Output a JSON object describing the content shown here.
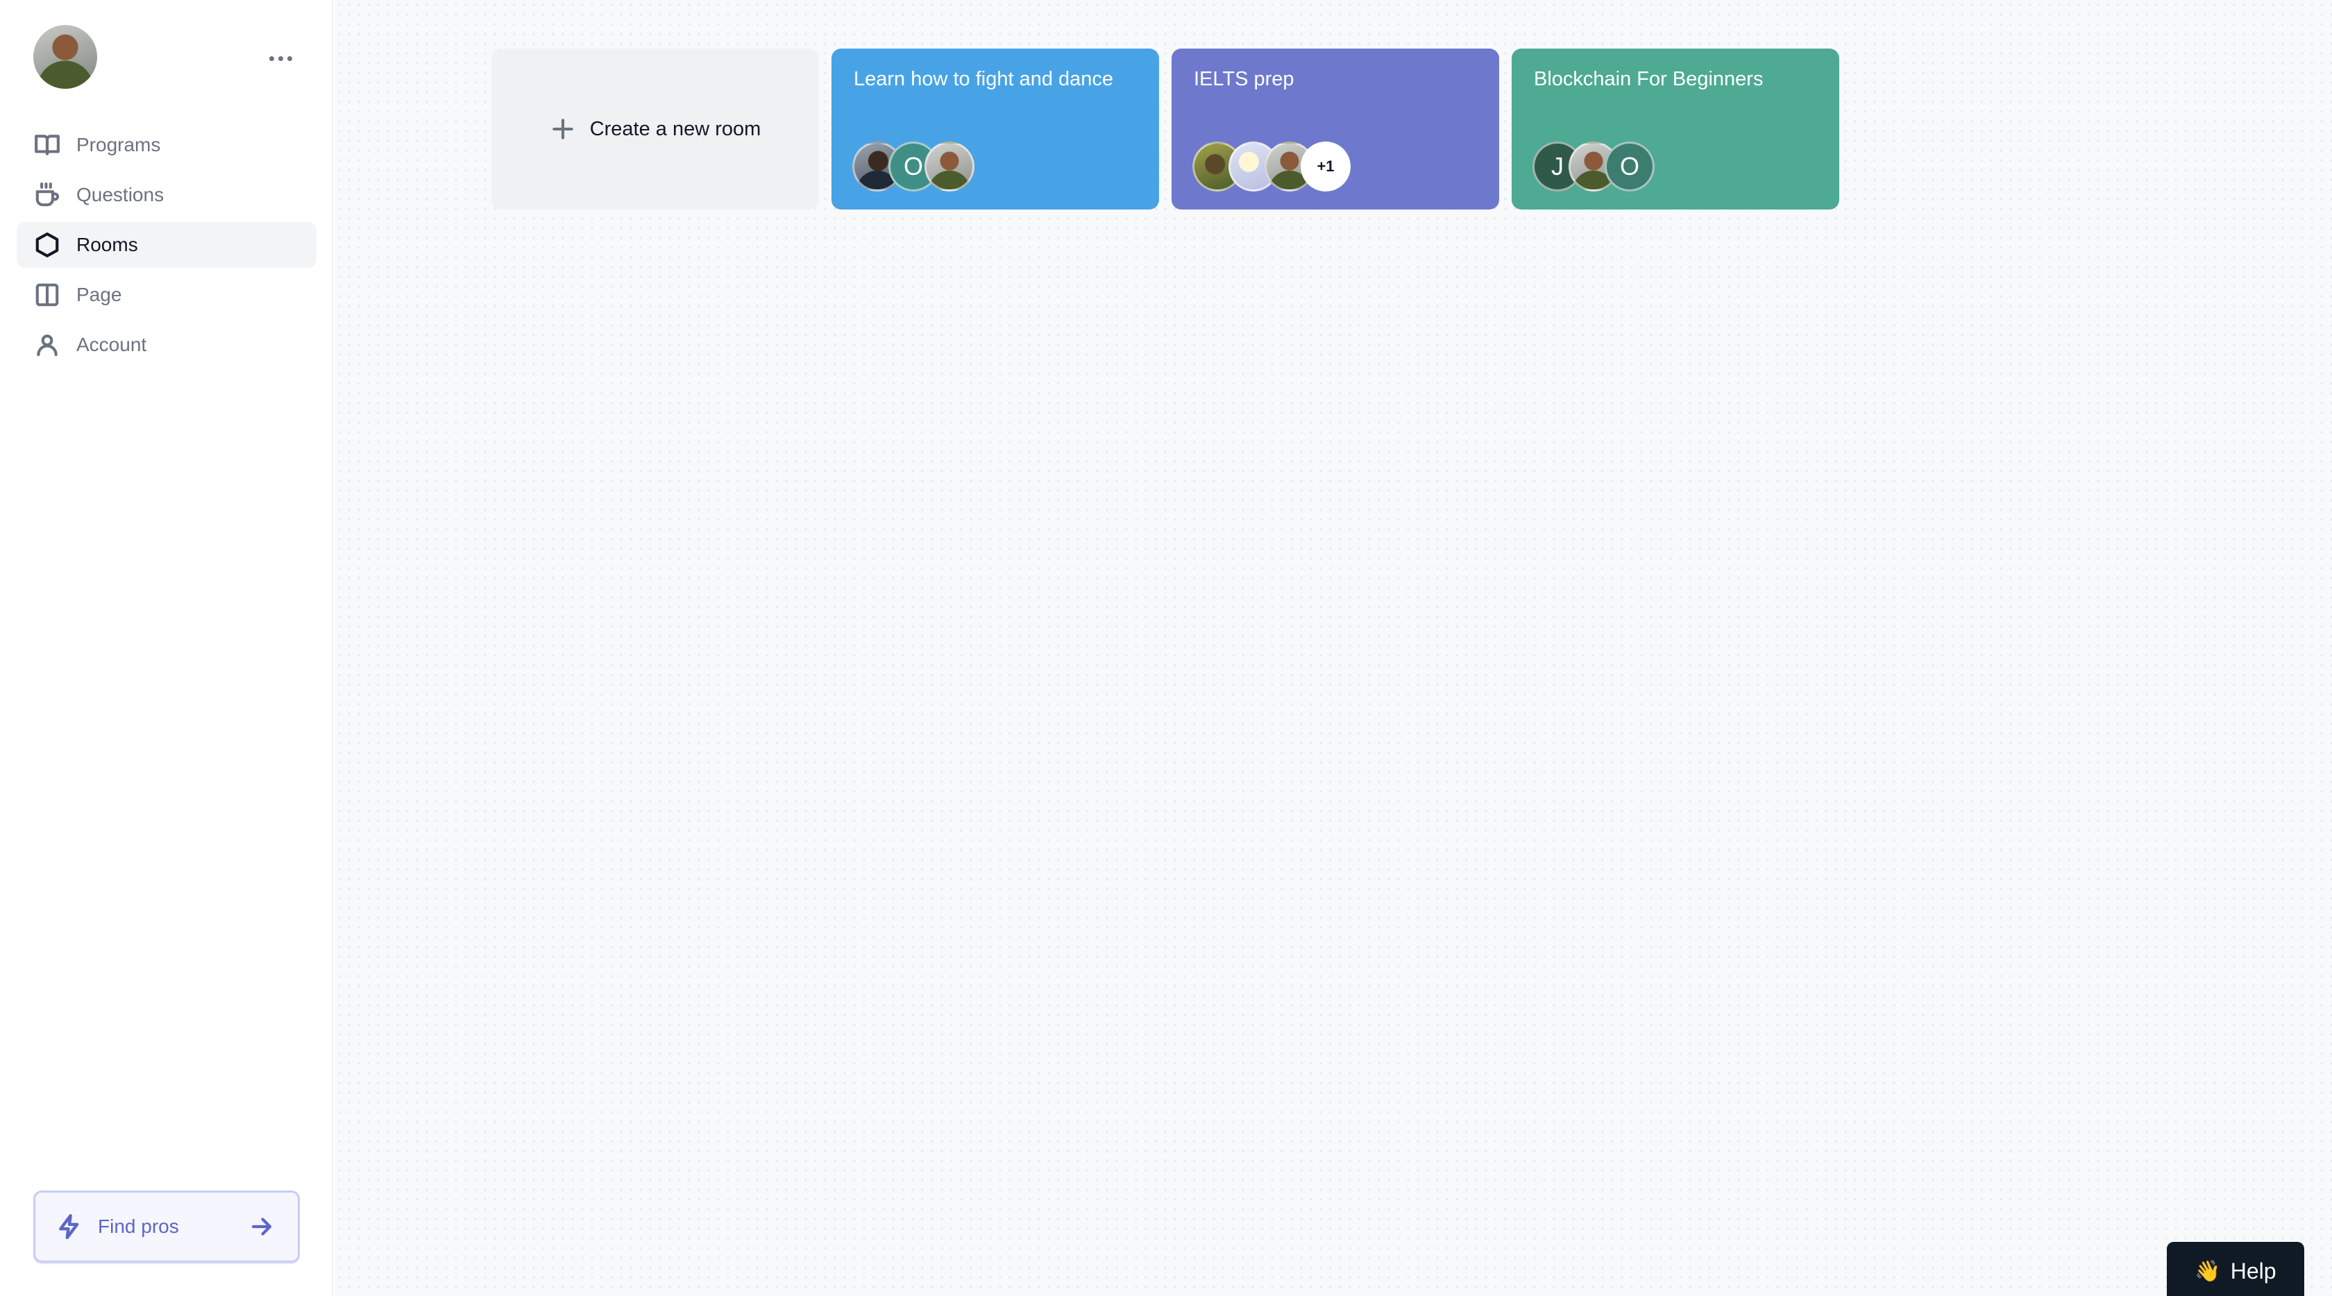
{
  "sidebar": {
    "items": [
      {
        "label": "Programs",
        "icon": "book-open-icon",
        "active": false
      },
      {
        "label": "Questions",
        "icon": "coffee-cup-icon",
        "active": false
      },
      {
        "label": "Rooms",
        "icon": "hexagon-icon",
        "active": true
      },
      {
        "label": "Page",
        "icon": "layout-columns-icon",
        "active": false
      },
      {
        "label": "Account",
        "icon": "user-icon",
        "active": false
      }
    ],
    "find_pros_label": "Find pros"
  },
  "main": {
    "create_room_label": "Create a new room",
    "rooms": [
      {
        "title": "Learn how to fight and dance",
        "color": "#48a3e6",
        "avatars": [
          {
            "type": "photo",
            "initial": ""
          },
          {
            "type": "initial",
            "initial": "O",
            "color": "#3f8f86"
          },
          {
            "type": "photo",
            "initial": ""
          }
        ]
      },
      {
        "title": "IELTS prep",
        "color": "#6e79cd",
        "avatars": [
          {
            "type": "photo",
            "initial": ""
          },
          {
            "type": "photo",
            "initial": ""
          },
          {
            "type": "photo",
            "initial": ""
          },
          {
            "type": "count",
            "initial": "+1"
          }
        ]
      },
      {
        "title": "Blockchain For Beginners",
        "color": "#4eaa93",
        "avatars": [
          {
            "type": "initial",
            "initial": "J",
            "color": "#2f5a4a"
          },
          {
            "type": "photo",
            "initial": ""
          },
          {
            "type": "initial",
            "initial": "O",
            "color": "#3d7d70"
          }
        ]
      }
    ]
  },
  "help": {
    "label": "Help",
    "emoji": "👋"
  }
}
